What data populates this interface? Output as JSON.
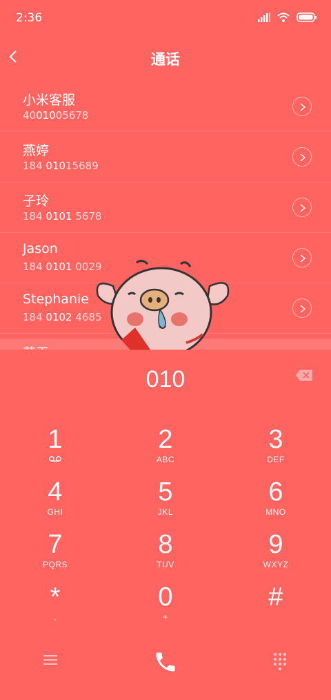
{
  "status": {
    "time": "2:36"
  },
  "header": {
    "title": "通话"
  },
  "contacts": [
    {
      "name": "小米客服",
      "pre": "40",
      "match": "010",
      "post": "05678"
    },
    {
      "name": "燕婷",
      "pre": "184 ",
      "match": "010",
      "post": "15689"
    },
    {
      "name": "子玲",
      "pre": "184 ",
      "match": "0101",
      "post": " 5678"
    },
    {
      "name": "Jason",
      "pre": "184 ",
      "match": "0101",
      "post": " 0029"
    },
    {
      "name": "Stephanie",
      "pre": "184 ",
      "match": "0102",
      "post": " 4685"
    }
  ],
  "peek_name": "苏玉",
  "dialer": {
    "input_value": "010",
    "keys": [
      {
        "num": "1",
        "letters": ""
      },
      {
        "num": "2",
        "letters": "ABC"
      },
      {
        "num": "3",
        "letters": "DEF"
      },
      {
        "num": "4",
        "letters": "GHI"
      },
      {
        "num": "5",
        "letters": "JKL"
      },
      {
        "num": "6",
        "letters": "MNO"
      },
      {
        "num": "7",
        "letters": "PQRS"
      },
      {
        "num": "8",
        "letters": "TUV"
      },
      {
        "num": "9",
        "letters": "WXYZ"
      },
      {
        "num": "*",
        "letters": ","
      },
      {
        "num": "0",
        "letters": "+"
      },
      {
        "num": "#",
        "letters": ""
      }
    ]
  },
  "icons": {
    "back": "chevron-left-icon",
    "voicemail": "voicemail-icon",
    "backspace": "backspace-icon",
    "menu": "menu-icon",
    "call": "phone-icon",
    "keypad": "keypad-icon"
  },
  "colors": {
    "background": "#FF6461",
    "text": "#FFFFFF"
  }
}
